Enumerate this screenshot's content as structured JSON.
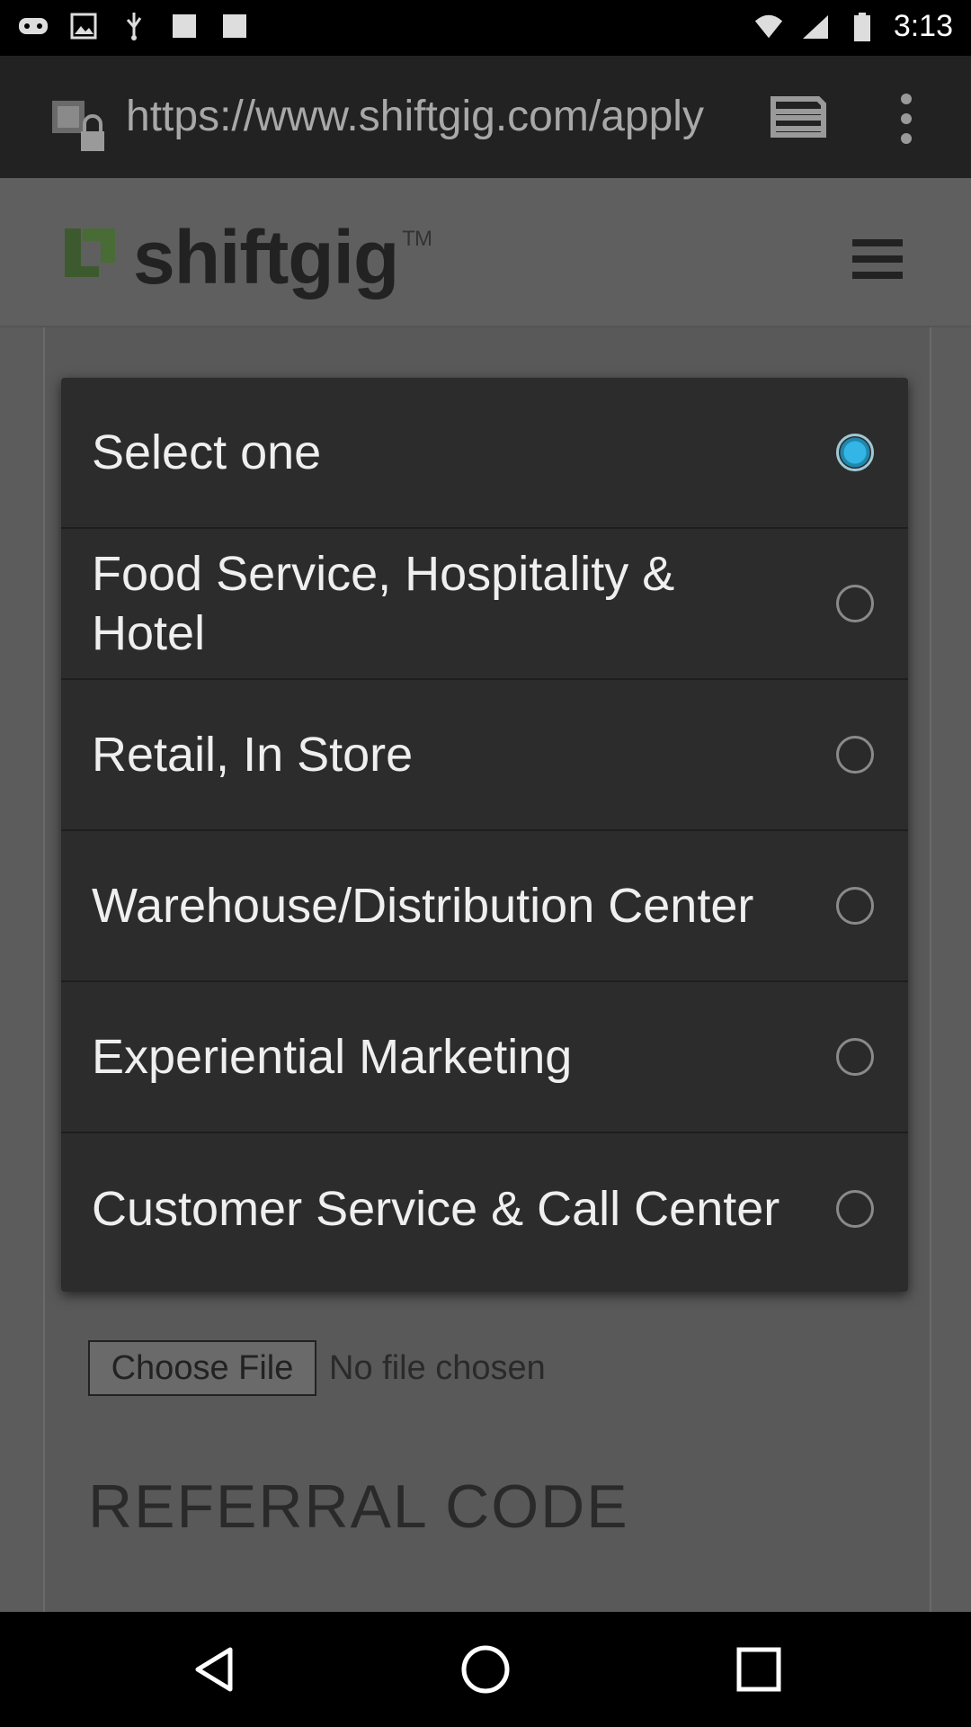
{
  "status_bar": {
    "time": "3:13",
    "left_icons": [
      "gamepad-icon",
      "image-icon",
      "usb-icon",
      "square-icon",
      "square-icon"
    ],
    "right_icons": [
      "wifi-icon",
      "signal-icon",
      "battery-icon"
    ]
  },
  "browser": {
    "url": "https://www.shiftgig.com/apply",
    "icons": [
      "lock-icon",
      "tabs-icon",
      "overflow-menu-icon"
    ]
  },
  "site": {
    "logo_text": "shiftgig",
    "logo_tm": "TM"
  },
  "page": {
    "choose_file_label": "Choose File",
    "no_file_text": "No file chosen",
    "referral_heading": "REFERRAL CODE"
  },
  "dialog": {
    "options": [
      {
        "label": "Select one",
        "checked": true
      },
      {
        "label": "Food Service, Hospitality & Hotel",
        "checked": false
      },
      {
        "label": "Retail, In Store",
        "checked": false
      },
      {
        "label": "Warehouse/Distribution Center",
        "checked": false
      },
      {
        "label": "Experiential Marketing",
        "checked": false
      },
      {
        "label": "Customer Service & Call Center",
        "checked": false
      }
    ]
  },
  "nav_bar": {
    "buttons": [
      "back-icon",
      "home-icon",
      "recents-icon"
    ]
  }
}
